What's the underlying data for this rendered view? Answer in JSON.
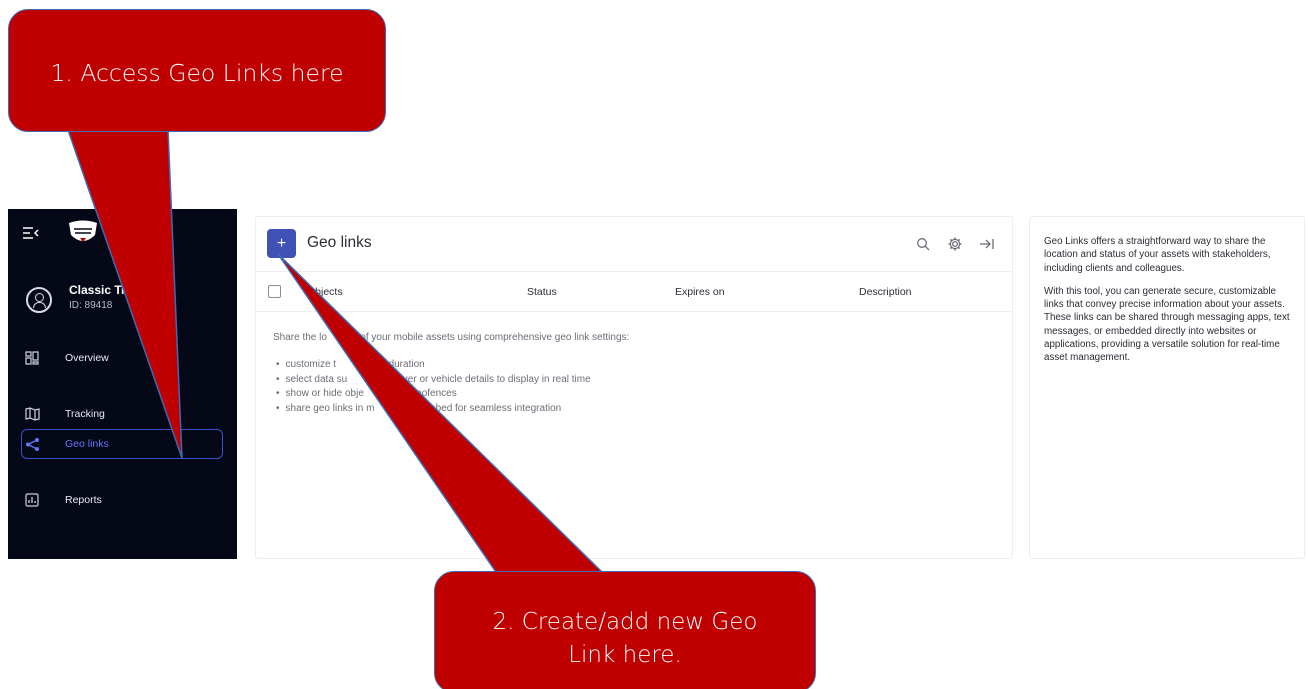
{
  "sidebar": {
    "user_name": "Classic Tr",
    "user_id": "ID: 89418",
    "items": [
      {
        "label": "Overview",
        "icon": "dashboard-icon"
      },
      {
        "label": "Tracking",
        "icon": "map-icon"
      },
      {
        "label": "Geo links",
        "icon": "share-icon",
        "active": true
      },
      {
        "label": "Reports",
        "icon": "chart-icon"
      }
    ]
  },
  "main": {
    "add_label": "+",
    "title": "Geo links",
    "columns": [
      "Objects",
      "Status",
      "Expires on",
      "Description"
    ],
    "empty_intro": "Share the lo         n of your mobile assets using comprehensive geo link settings:",
    "bullets": [
      "customize t          link's duration",
      "select data su          ed, driver or vehicle details to display in real time",
      "show or hide obje          tain geofences",
      "share geo links in m          s or embed for seamless integration"
    ]
  },
  "info": {
    "paragraph_1": "Geo Links offers a straightforward way to share the location and status of your assets with stakeholders, including clients and colleagues.",
    "paragraph_2": "With this tool, you can generate secure, customizable links that convey precise information about your assets. These links can be shared through messaging apps, text messages, or embedded directly into websites or applications, providing a versatile solution for real-time asset management."
  },
  "callouts": {
    "first": "1. Access Geo Links here",
    "second_line_1": "2. Create/add new Geo",
    "second_line_2": "Link here."
  },
  "colors": {
    "sidebar_bg": "#050816",
    "accent": "#3f51b5",
    "active_link": "#6276ff",
    "callout_red": "#c00000",
    "callout_border": "#3b6bb4"
  }
}
